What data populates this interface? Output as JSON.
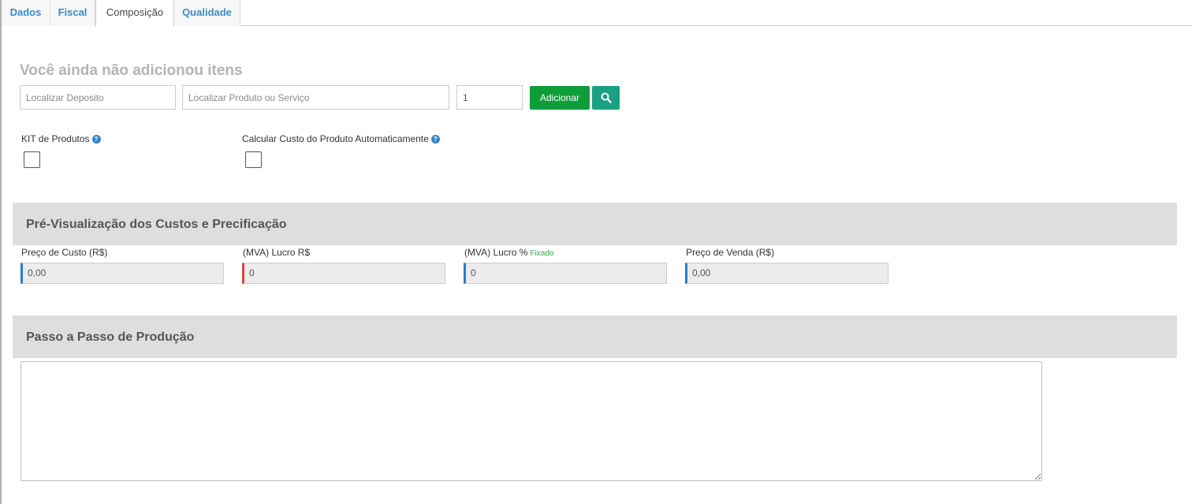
{
  "tabs": [
    {
      "label": "Dados"
    },
    {
      "label": "Fiscal"
    },
    {
      "label": "Composição"
    },
    {
      "label": "Qualidade"
    }
  ],
  "empty_state_title": "Você ainda não adicionou itens",
  "add_item": {
    "deposit_placeholder": "Localizar Deposito",
    "product_placeholder": "Localizar Produto ou Serviço",
    "quantity_value": "1",
    "add_button_label": "Adicionar",
    "search_icon": "search-icon"
  },
  "options": {
    "kit_label": "KIT de Produtos",
    "auto_cost_label": "Calcular Custo do Produto Automaticamente",
    "help_icon": "question-circle-icon",
    "kit_checked": false,
    "auto_cost_checked": false
  },
  "pricing": {
    "section_title": "Pré-Visualização dos Custos e Precificação",
    "cost_label": "Preço de Custo (R$)",
    "cost_value": "0,00",
    "mva_value_label": "(MVA) Lucro R$",
    "mva_value": "0",
    "mva_percent_label": "(MVA) Lucro %",
    "mva_percent_tag": "Fixado",
    "mva_percent_value": "0",
    "sale_label": "Preço de Venda (R$)",
    "sale_value": "0,00"
  },
  "production": {
    "section_title": "Passo a Passo de Produção",
    "steps_text": ""
  },
  "colors": {
    "tab_link": "#3a8dc4",
    "add_button": "#0f9d3a",
    "search_button": "#1aa082",
    "section_bar": "#dedede",
    "accent_blue": "#2a7ad6",
    "accent_red": "#d9443c",
    "fixado_green": "#2fa84a"
  }
}
